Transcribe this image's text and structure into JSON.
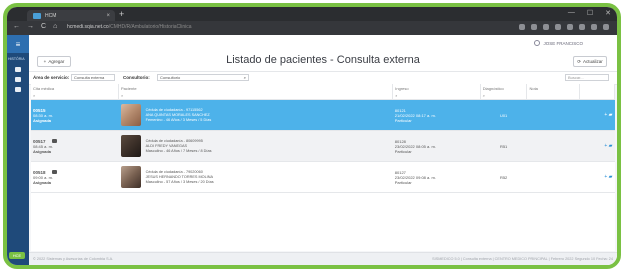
{
  "browser": {
    "tab_title": "HCM",
    "tab_close": "×",
    "new_tab": "+",
    "url_host": "hcmedi.sqia.net.co",
    "url_path": "/CMHD/R/Ambulatorio/HistoriaClinica",
    "window_controls": [
      "—",
      "☐",
      "✕"
    ],
    "nav_icons": [
      "←",
      "→",
      "C",
      "⌂"
    ]
  },
  "sidebar": {
    "menu_icon": "≡",
    "label": "HISTÓRIA",
    "badge": "HCE"
  },
  "user": {
    "name": "JOSE FRANCISCO"
  },
  "toolbar": {
    "add_label": "Agregar",
    "title": "Listado de pacientes - Consulta externa",
    "update_label": "Actualizar"
  },
  "filters": {
    "area_label": "Área de servicio:",
    "area_value": "Consulta externa",
    "consultorio_label": "Consultorio:",
    "consultorio_value": "Consultorio",
    "search_placeholder": "Buscar..."
  },
  "table": {
    "columns": [
      "Cita médica",
      "Paciente",
      "Ingreso",
      "Diagnóstico",
      "Nota",
      ""
    ],
    "rows": [
      {
        "cita_num": "00515",
        "cita_time": "08:30 a. m.",
        "cita_status": "Asignada",
        "doc": "Cédula de ciudadanía - 97115562",
        "name": "ANA QUINTAS MORALES SANCHEZ",
        "demo": "Femenino - 46 Años / 3 Meses / 5 Días",
        "ingreso_num": "80121",
        "ingreso_date": "21/02/2022 08:17 a. m.",
        "ingreso_type": "Particular",
        "diag": "U01",
        "selected": true
      },
      {
        "cita_num": "00517",
        "cita_time": "08:45 a. m.",
        "cita_status": "Asignada",
        "doc": "Cédula de ciudadanía - 80609995",
        "name": "ALDI FREDY VANEGAS",
        "demo": "Masculino - 46 Años / 7 Meses / 8 Días",
        "ingreso_num": "80128",
        "ingreso_date": "23/02/2022 08:05 a. m.",
        "ingreso_type": "Particular",
        "diag": "R51",
        "selected": false
      },
      {
        "cita_num": "00518",
        "cita_time": "09:00 a. m.",
        "cita_status": "Asignada",
        "doc": "Cédula de ciudadanía - 79020060",
        "name": "JESUS HERNANDO TORRES MOLINA",
        "demo": "Masculino - 57 Años / 3 Meses / 20 Días",
        "ingreso_num": "80127",
        "ingreso_date": "23/02/2022 09:08 a. m.",
        "ingreso_type": "Particular",
        "diag": "R52",
        "selected": false
      }
    ]
  },
  "footer": {
    "left": "© 2022 Sistemas y Asesorías de Colombia S.A.",
    "right": "SISMEDICO 5.0 | Consulta externa | CENTRO MEDICO PRINCIPAL | Febrero 2022 Segundo 10 Fecha: 24"
  },
  "colors": {
    "accent_green": "#7ac143",
    "sidebar_blue": "#1f4a7a",
    "selected_row": "#4db2ea"
  }
}
